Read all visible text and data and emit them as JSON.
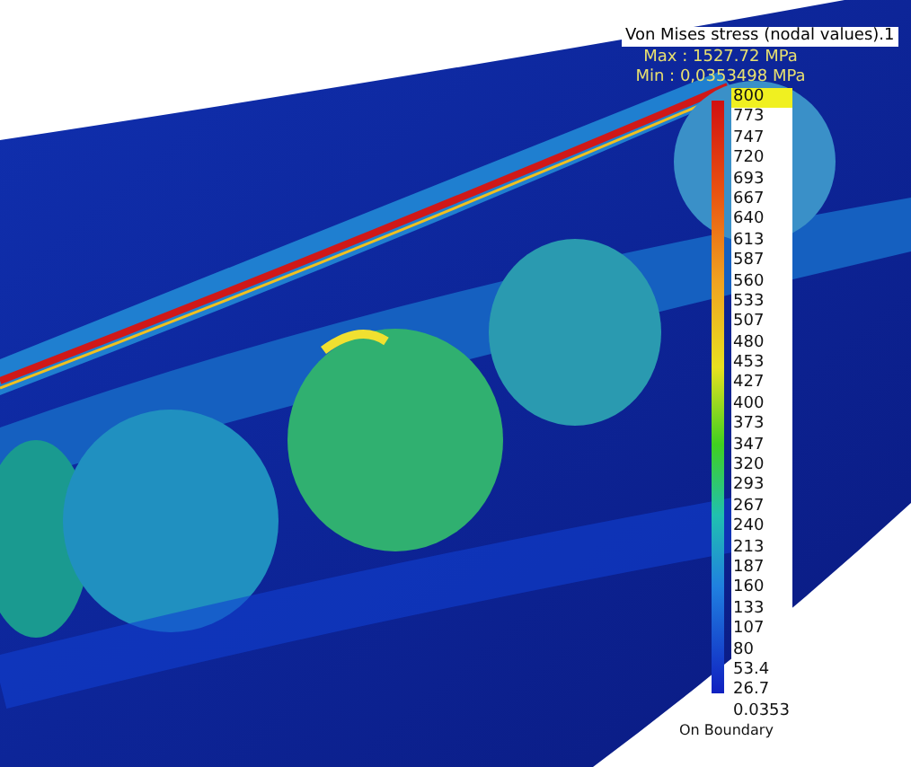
{
  "legend": {
    "title": "Von Mises stress (nodal values).1",
    "max": "Max : 1527.72 MPa",
    "min": "Min : 0,0353498 MPa",
    "values": [
      {
        "label": "800",
        "selected": true
      },
      {
        "label": "773",
        "selected": false
      },
      {
        "label": "747",
        "selected": false
      },
      {
        "label": "720",
        "selected": false
      },
      {
        "label": "693",
        "selected": false
      },
      {
        "label": "667",
        "selected": false
      },
      {
        "label": "640",
        "selected": false
      },
      {
        "label": "613",
        "selected": false
      },
      {
        "label": "587",
        "selected": false
      },
      {
        "label": "560",
        "selected": false
      },
      {
        "label": "533",
        "selected": false
      },
      {
        "label": "507",
        "selected": false
      },
      {
        "label": "480",
        "selected": false
      },
      {
        "label": "453",
        "selected": false
      },
      {
        "label": "427",
        "selected": false
      },
      {
        "label": "400",
        "selected": false
      },
      {
        "label": "373",
        "selected": false
      },
      {
        "label": "347",
        "selected": false
      },
      {
        "label": "320",
        "selected": false
      },
      {
        "label": "293",
        "selected": false
      },
      {
        "label": "267",
        "selected": false
      },
      {
        "label": "240",
        "selected": false
      },
      {
        "label": "213",
        "selected": false
      },
      {
        "label": "187",
        "selected": false
      },
      {
        "label": "160",
        "selected": false
      },
      {
        "label": "133",
        "selected": false
      },
      {
        "label": "107",
        "selected": false
      },
      {
        "label": "80",
        "selected": false
      },
      {
        "label": "53.4",
        "selected": false
      },
      {
        "label": "26.7",
        "selected": false
      },
      {
        "label": "0.0353",
        "selected": false
      }
    ],
    "footer": "On Boundary"
  }
}
